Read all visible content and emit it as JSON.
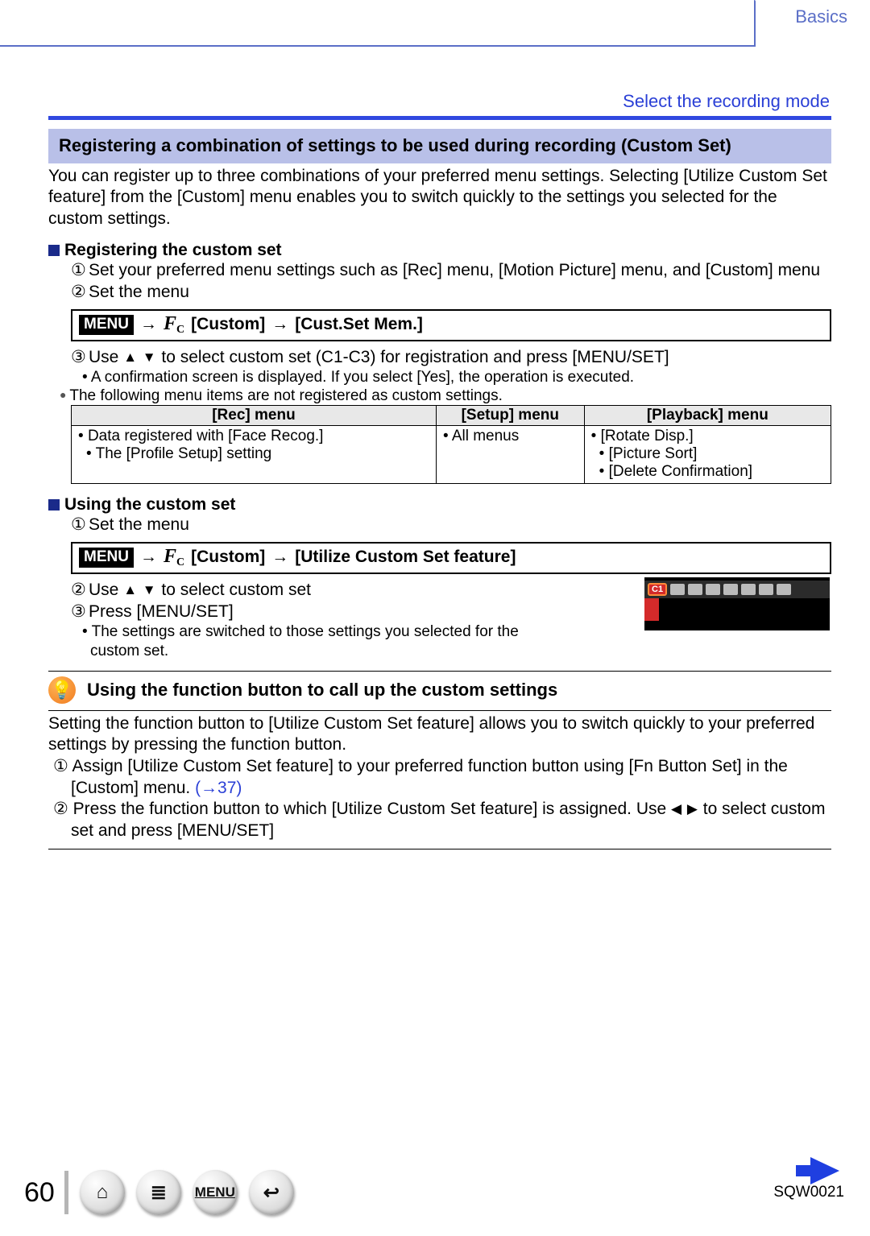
{
  "header": {
    "chapter": "Basics",
    "section_link": "Select the recording mode"
  },
  "banner": "Registering a combination of settings to be used during recording (Custom Set)",
  "intro": "You can register up to three combinations of your preferred menu settings. Selecting [Utilize Custom Set feature] from the [Custom] menu enables you to switch quickly to the settings you selected for the custom settings.",
  "register": {
    "heading": "Registering the custom set",
    "step1": "Set your preferred menu settings such as [Rec] menu, [Motion Picture] menu, and [Custom] menu",
    "step2": "Set the menu",
    "path": {
      "menu": "MENU",
      "custom": "[Custom]",
      "target": "[Cust.Set Mem.]"
    },
    "step3_pre": "Use ",
    "step3_post": " to select custom set (C1-C3) for registration and press [MENU/SET]",
    "note": "A confirmation screen is displayed. If you select [Yes], the operation is executed.",
    "lead": "The following menu items are not registered as custom settings.",
    "table": {
      "headers": [
        "[Rec] menu",
        "[Setup] menu",
        "[Playback] menu"
      ],
      "rec": [
        "Data registered with [Face Recog.]",
        "The [Profile Setup] setting"
      ],
      "setup": [
        "All menus"
      ],
      "playback": [
        "[Rotate Disp.]",
        "[Picture Sort]",
        "[Delete Confirmation]"
      ]
    }
  },
  "use": {
    "heading": "Using the custom set",
    "step1": "Set the menu",
    "path": {
      "menu": "MENU",
      "custom": "[Custom]",
      "target": "[Utilize Custom Set feature]"
    },
    "step2_pre": "Use ",
    "step2_post": " to select custom set",
    "step3": "Press [MENU/SET]",
    "note": "The settings are switched to those settings you selected for the custom set.",
    "thumb_badge": "C1"
  },
  "tip": {
    "heading": "Using the function button to call up the custom settings",
    "intro": "Setting the function button to [Utilize Custom Set feature] allows you to switch quickly to your preferred settings by pressing the function button.",
    "step1_pre": "Assign [Utilize Custom Set feature] to your preferred function button using [Fn Button Set] in the [Custom] menu. ",
    "step1_ref": "(→37)",
    "step2_pre": "Press the function button to which [Utilize Custom Set feature] is assigned. Use ",
    "step2_post": " to select custom set and press [MENU/SET]"
  },
  "footer": {
    "page": "60",
    "menu_label": "MENU",
    "doc_code": "SQW0021"
  }
}
